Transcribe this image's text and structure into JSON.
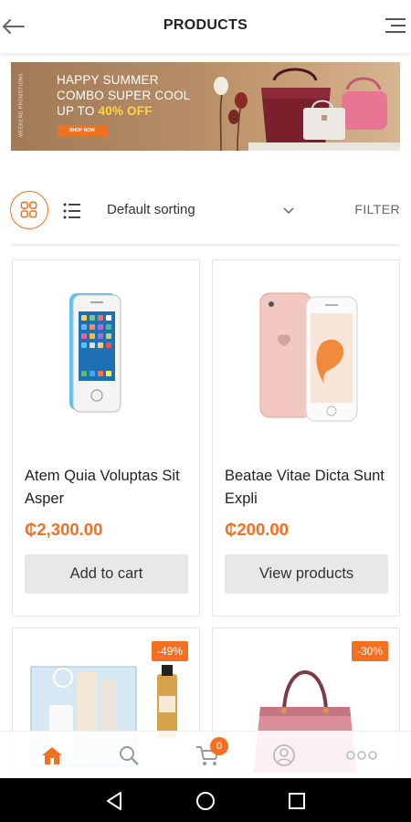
{
  "header": {
    "title": "PRODUCTS"
  },
  "banner": {
    "side_text": "WEEKEND PROMOTIONS",
    "line1": "HAPPY SUMMER",
    "line2": "COMBO SUPER COOL",
    "line3_prefix": "UP TO ",
    "line3_highlight": "40% OFF",
    "button": "SHOP NOW"
  },
  "toolbar": {
    "sorting": "Default sorting",
    "filter": "FILTER"
  },
  "products": [
    {
      "name": "Atem Quia Voluptas Sit Asper",
      "price": "₵2,300.00",
      "cta": "Add to cart",
      "image": "iphone-5s-image"
    },
    {
      "name": "Beatae Vitae Dicta Sunt Expli",
      "price": "₵200.00",
      "cta": "View products",
      "image": "iphone-6-rose-gold-image"
    },
    {
      "badge": "-49%",
      "image": "cosmetics-set-image"
    },
    {
      "badge": "-30%",
      "image": "pink-handbag-image"
    }
  ],
  "bottom_nav": {
    "items": [
      "home-icon",
      "search-icon",
      "cart-icon",
      "account-icon",
      "more-icon"
    ],
    "cart_count": "0"
  },
  "colors": {
    "accent": "#f36f21",
    "highlight": "#ffd53d",
    "button_bg": "#e8e8e8"
  }
}
